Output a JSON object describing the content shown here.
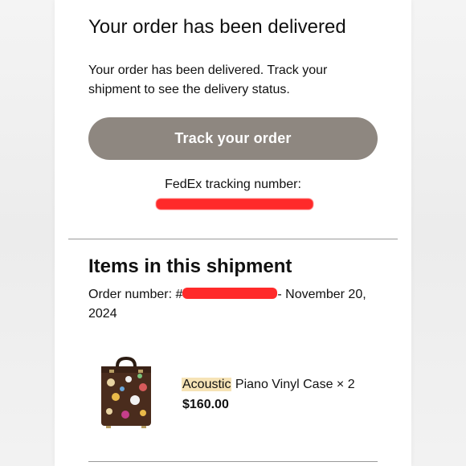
{
  "header": {
    "title": "Your order has been delivered",
    "description": "Your order has been delivered. Track your shipment to see the delivery status."
  },
  "tracking": {
    "button_label": "Track your order",
    "label": "FedEx tracking number:",
    "number": ""
  },
  "shipment": {
    "heading": "Items in this shipment",
    "order_prefix": "Order number: #",
    "order_number": "",
    "order_date_separator": "- November 20, 2024"
  },
  "item": {
    "name_highlight": "Acoustic",
    "name_rest": " Piano Vinyl Case × 2",
    "price": "$160.00"
  },
  "colors": {
    "button_bg": "#8e8780",
    "redaction": "#ff2a2a",
    "highlight": "#f6e3b6"
  }
}
